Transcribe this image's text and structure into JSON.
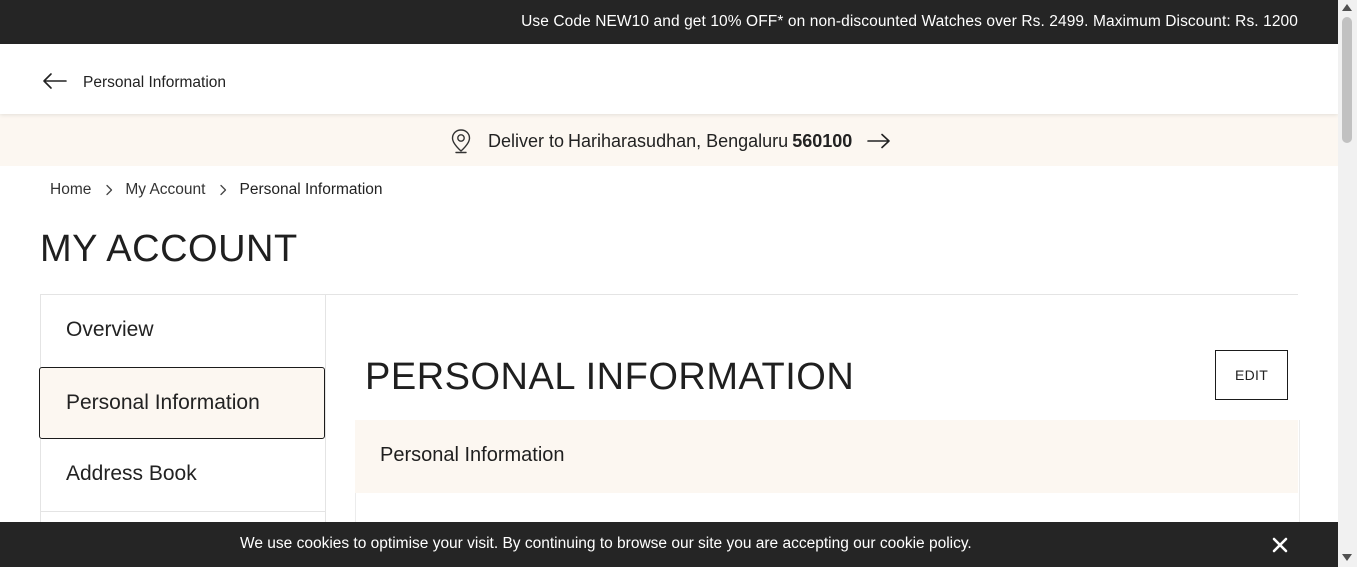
{
  "promo": {
    "text": "Use Code NEW10 and get 10% OFF* on non-discounted Watches over Rs. 2499. Maximum Discount: Rs. 1200"
  },
  "header": {
    "back_icon": "arrow-left-icon",
    "title": "Personal Information"
  },
  "delivery": {
    "icon": "location-pin-icon",
    "label": "Deliver to",
    "name": "Hariharasudhan, Bengaluru",
    "pincode": "560100",
    "arrow_icon": "arrow-right-icon"
  },
  "breadcrumb": {
    "items": [
      "Home",
      "My Account",
      "Personal Information"
    ],
    "separator_icon": "chevron-right-icon"
  },
  "page": {
    "title": "MY ACCOUNT"
  },
  "sidebar": {
    "items": [
      {
        "label": "Overview",
        "active": false
      },
      {
        "label": "Personal Information",
        "active": true
      },
      {
        "label": "Address Book",
        "active": false
      }
    ]
  },
  "main": {
    "title": "PERSONAL INFORMATION",
    "edit_label": "EDIT",
    "section_title": "Personal Information"
  },
  "cookie": {
    "text": "We use cookies to optimise your visit. By continuing to browse our site you are accepting our cookie policy.",
    "close_icon": "close-icon"
  },
  "colors": {
    "dark_bar": "#252525",
    "cream": "#fcf7f1",
    "text": "#222222",
    "border": "#e4e4e4"
  }
}
